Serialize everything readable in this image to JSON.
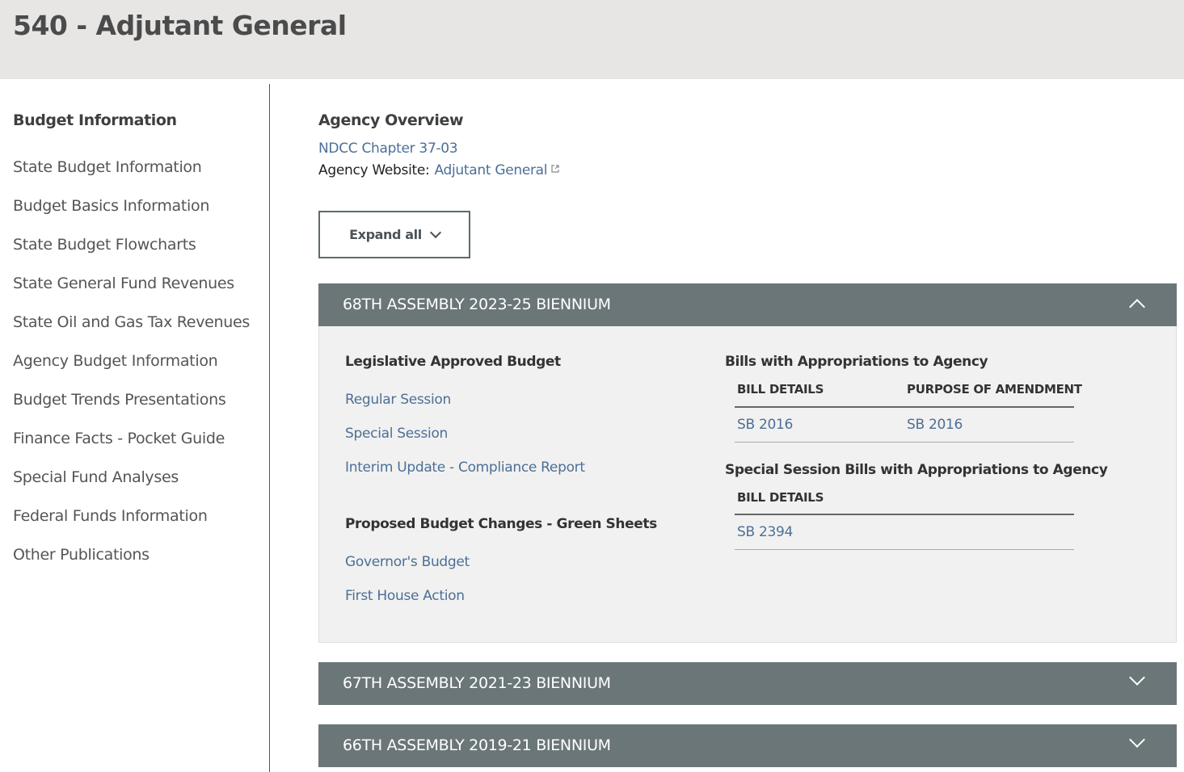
{
  "page": {
    "title": "540 - Adjutant General"
  },
  "sidebar": {
    "heading": "Budget Information",
    "items": [
      {
        "label": "State Budget Information"
      },
      {
        "label": "Budget Basics Information"
      },
      {
        "label": "State Budget Flowcharts"
      },
      {
        "label": "State General Fund Revenues"
      },
      {
        "label": "State Oil and Gas Tax Revenues"
      },
      {
        "label": "Agency Budget Information"
      },
      {
        "label": "Budget Trends Presentations"
      },
      {
        "label": "Finance Facts - Pocket Guide"
      },
      {
        "label": "Special Fund Analyses"
      },
      {
        "label": "Federal Funds Information"
      },
      {
        "label": "Other Publications"
      }
    ]
  },
  "overview": {
    "title": "Agency Overview",
    "ndcc_link": "NDCC Chapter 37-03",
    "website_label": "Agency Website:",
    "website_link": "Adjutant General"
  },
  "expand_all": {
    "label": "Expand all"
  },
  "accordions": [
    {
      "label": "68TH ASSEMBLY 2023-25 BIENNIUM",
      "state": "expanded"
    },
    {
      "label": "67TH ASSEMBLY 2021-23 BIENNIUM",
      "state": "collapsed"
    },
    {
      "label": "66TH ASSEMBLY 2019-21 BIENNIUM",
      "state": "collapsed"
    }
  ],
  "biennium_2023": {
    "legislative": {
      "title": "Legislative Approved Budget",
      "links": [
        "Regular Session",
        "Special Session",
        "Interim Update - Compliance Report"
      ]
    },
    "proposed": {
      "title": "Proposed Budget Changes - Green Sheets",
      "links": [
        "Governor's Budget",
        "First House Action"
      ]
    },
    "bills": {
      "title": "Bills with Appropriations to Agency",
      "col_bill": "BILL DETAILS",
      "col_purpose": "PURPOSE OF AMENDMENT",
      "rows": [
        {
          "bill": "SB 2016",
          "purpose": "SB 2016"
        }
      ]
    },
    "special_bills": {
      "title": "Special Session Bills with Appropriations to Agency",
      "col_bill": "BILL DETAILS",
      "rows": [
        {
          "bill": "SB 2394"
        }
      ]
    }
  },
  "colors": {
    "header_bg": "#e7e6e5",
    "accordion_bg": "#6b7678",
    "link": "#4c6f96"
  },
  "icons": {
    "external": "external-link-icon",
    "expand": "chevron-down-icon",
    "collapse": "chevron-up-icon"
  }
}
